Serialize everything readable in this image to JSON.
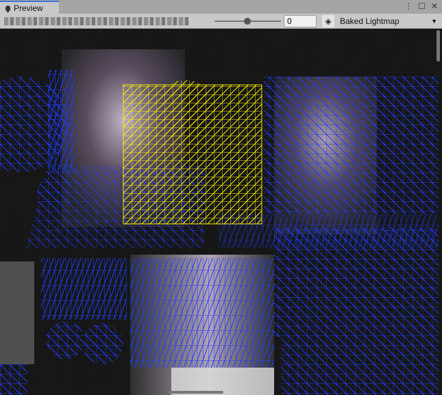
{
  "window": {
    "tab_label": "Preview",
    "menu_icon": "kebab-icon",
    "maximize_icon": "maximize-icon",
    "close_icon": "close-icon"
  },
  "toolbar": {
    "exposure_value": "0",
    "exposure_slider": 0.5,
    "mode_icon": "layers-icon",
    "mode_selected": "Baked Lightmap"
  },
  "colors": {
    "wire": "#1f3dff",
    "selection": "#ffee00",
    "background": "#161616"
  }
}
